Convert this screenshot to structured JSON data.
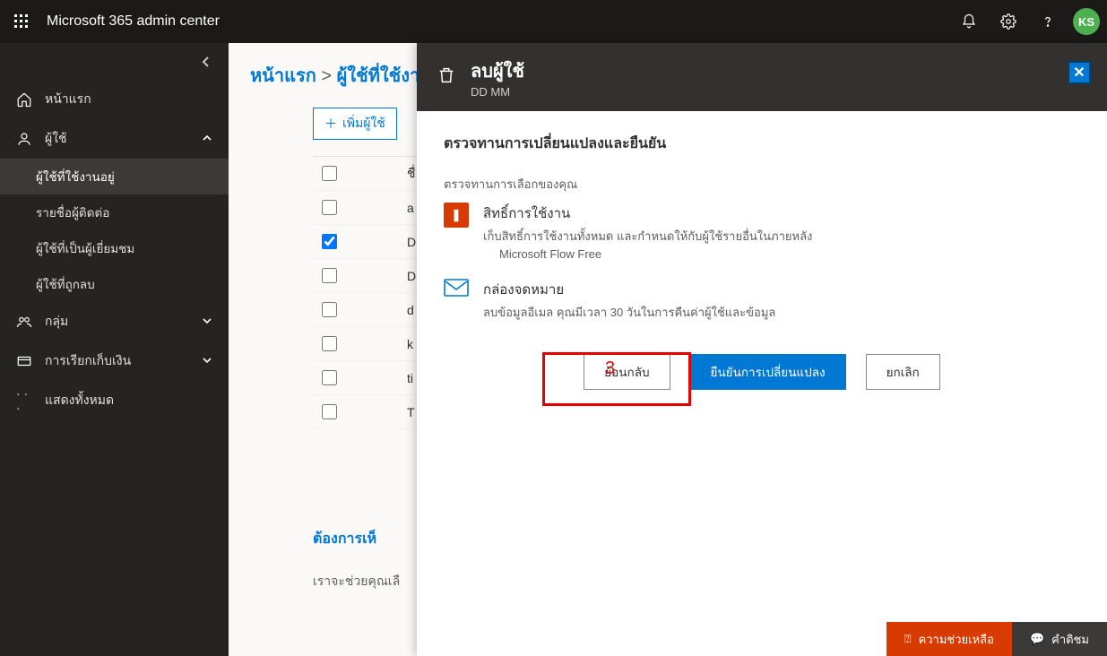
{
  "header": {
    "title": "Microsoft 365 admin center",
    "avatar": "KS"
  },
  "sidebar": {
    "home": "หน้าแรก",
    "users": "ผู้ใช้",
    "users_sub": [
      "ผู้ใช้ที่ใช้งานอยู่",
      "รายชื่อผู้ติดต่อ",
      "ผู้ใช้ที่เป็นผู้เยี่ยมชม",
      "ผู้ใช้ที่ถูกลบ"
    ],
    "groups": "กลุ่ม",
    "billing": "การเรียกเก็บเงิน",
    "showall": "แสดงทั้งหมด"
  },
  "main": {
    "breadcrumb_home": "หน้าแรก",
    "breadcrumb_users": "ผู้ใช้ที่ใช้งา",
    "add_user": "เพิ่มผู้ใช้",
    "col_name": "ชื่",
    "rows": [
      "a",
      "D",
      "D",
      "d",
      "k",
      "ti",
      "T"
    ],
    "checked_index": 1,
    "footer_q": "ต้องการเห็",
    "footer_s": "เราจะช่วยคุณเลื"
  },
  "panel": {
    "title": "ลบผู้ใช้",
    "subtitle": "DD MM",
    "heading": "ตรวจทานการเปลี่ยนแปลงและยืนยัน",
    "review_label": "ตรวจทานการเลือกของคุณ",
    "license_title": "สิทธิ์การใช้งาน",
    "license_desc": "เก็บสิทธิ์การใช้งานทั้งหมด และกำหนดให้กับผู้ใช้รายอื่นในภายหลัง",
    "license_product": "Microsoft Flow Free",
    "mailbox_title": "กล่องจดหมาย",
    "mailbox_desc": "ลบข้อมูลอีเมล คุณมีเวลา 30 วันในการคืนค่าผู้ใช้และข้อมูล",
    "btn_back": "ย้อนกลับ",
    "btn_confirm": "ยืนยันการเปลี่ยนแปลง",
    "btn_cancel": "ยกเลิก",
    "annotation_number": "3"
  },
  "helpbar": {
    "need": "ความช่วยเหลือ",
    "feedback": "คำติชม"
  }
}
